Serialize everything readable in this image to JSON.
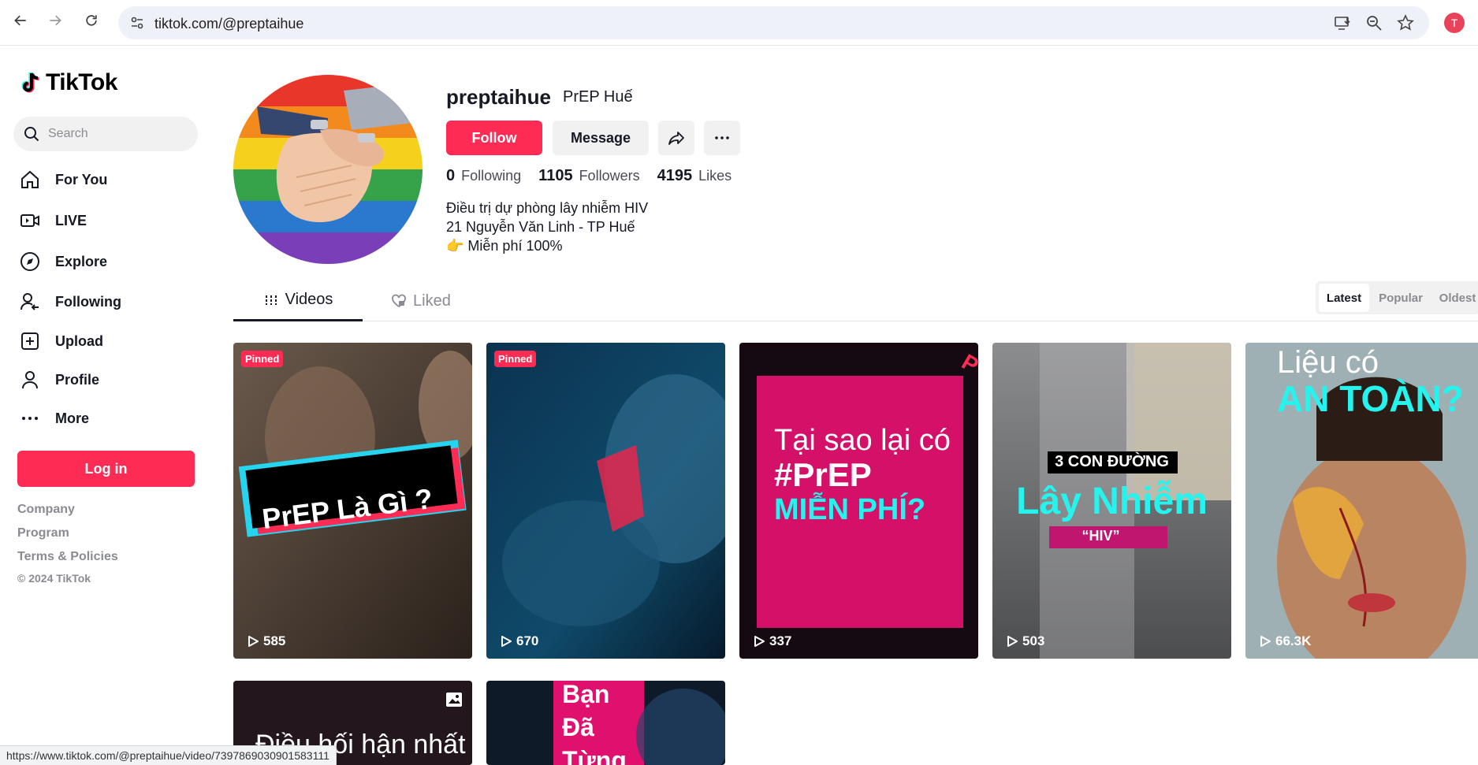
{
  "browser": {
    "url": "tiktok.com/@preptaihue",
    "profile_initial": "T"
  },
  "sidebar": {
    "logo_text": "TikTok",
    "search_placeholder": "Search",
    "items": [
      {
        "label": "For You",
        "icon": "home-icon"
      },
      {
        "label": "LIVE",
        "icon": "live-icon"
      },
      {
        "label": "Explore",
        "icon": "compass-icon"
      },
      {
        "label": "Following",
        "icon": "following-icon"
      },
      {
        "label": "Upload",
        "icon": "upload-icon"
      },
      {
        "label": "Profile",
        "icon": "profile-icon"
      },
      {
        "label": "More",
        "icon": "more-icon"
      }
    ],
    "login_label": "Log in",
    "footer_links": [
      "Company",
      "Program",
      "Terms & Policies"
    ],
    "copyright": "© 2024 TikTok"
  },
  "profile": {
    "username": "preptaihue",
    "nickname": "PrEP Huế",
    "follow_label": "Follow",
    "message_label": "Message",
    "following_count": "0",
    "following_label": "Following",
    "followers_count": "1105",
    "followers_label": "Followers",
    "likes_count": "4195",
    "likes_label": "Likes",
    "bio": [
      "Điều trị dự phòng lây nhiễm HIV",
      "21 Nguyễn Văn Linh - TP Huế",
      "👉 Miễn phí 100%"
    ]
  },
  "tabs": {
    "videos": "Videos",
    "liked": "Liked",
    "sort": [
      "Latest",
      "Popular",
      "Oldest"
    ],
    "active_sort": "Latest"
  },
  "videos": [
    {
      "pinned": "Pinned",
      "views": "585",
      "caption": "PrEP Là Gì ?"
    },
    {
      "pinned": "Pinned",
      "views": "670",
      "caption": ""
    },
    {
      "views": "337",
      "caption_lines": [
        "Tại sao lại có",
        "#PrEP",
        "MIỄN PHÍ?"
      ]
    },
    {
      "views": "503",
      "caption_lines": [
        "3 CON ĐƯỜNG",
        "Lây Nhiễm",
        "“HIV”"
      ]
    },
    {
      "views": "66.3K",
      "caption_lines": [
        "Liệu có",
        "AN TOÀN?"
      ]
    },
    {
      "caption": "Điều hối hận nhất"
    },
    {
      "caption_lines": [
        "Bạn",
        "Đã",
        "Từng"
      ]
    }
  ],
  "status_url": "https://www.tiktok.com/@preptaihue/video/7397869030901583111",
  "colors": {
    "brand": "#fe2c55",
    "text": "#161823",
    "muted": "#8a8b91",
    "cyan": "#25f4ee",
    "magenta": "#d9106f"
  }
}
